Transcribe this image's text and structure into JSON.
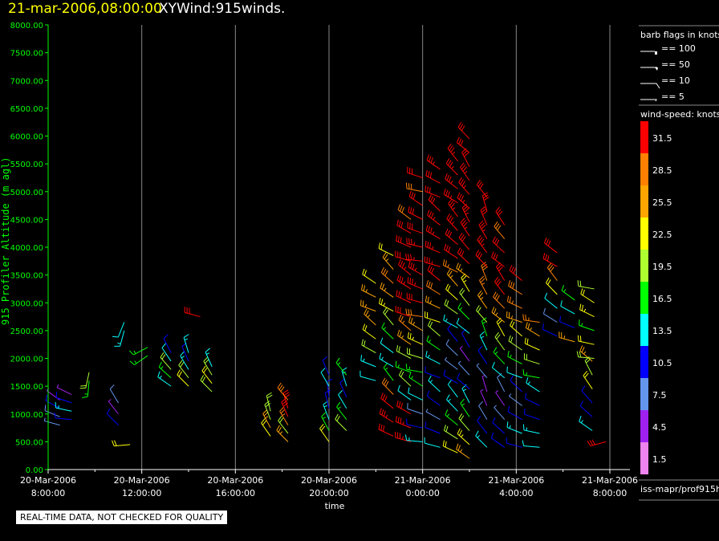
{
  "header": {
    "date": "21-mar-2006,08:00:00",
    "title": "XYWind:915winds."
  },
  "notice": "REAL-TIME DATA, NOT CHECKED FOR QUALITY",
  "source": "iss-mapr/prof915h",
  "legend": {
    "barb_title": "barb flags in knots",
    "barb_items": [
      "== 100",
      "== 50",
      "== 10",
      "== 5"
    ],
    "speed_title": "wind-speed: knots",
    "speed_bins": [
      {
        "label": "31.5",
        "color": "#ff0000"
      },
      {
        "label": "28.5",
        "color": "#ff8000"
      },
      {
        "label": "25.5",
        "color": "#ffa500"
      },
      {
        "label": "22.5",
        "color": "#ffff00"
      },
      {
        "label": "19.5",
        "color": "#adff2f"
      },
      {
        "label": "16.5",
        "color": "#00ff00"
      },
      {
        "label": "13.5",
        "color": "#00ffff"
      },
      {
        "label": "10.5",
        "color": "#0000ff"
      },
      {
        "label": "7.5",
        "color": "#6495ed"
      },
      {
        "label": "4.5",
        "color": "#a020f0"
      },
      {
        "label": "1.5",
        "color": "#ee82ee"
      }
    ]
  },
  "chart_data": {
    "type": "wind-barb",
    "xlabel": "time",
    "ylabel": "915 Profiler Altitude (m agl)",
    "xlim": [
      "2006-03-20 08:00",
      "2006-03-21 08:00"
    ],
    "ylim": [
      0,
      8000
    ],
    "yticks": [
      "0.00",
      "500.00",
      "1000.00",
      "1500.00",
      "2000.00",
      "2500.00",
      "3000.00",
      "3500.00",
      "4000.00",
      "4500.00",
      "5000.00",
      "5500.00",
      "6000.00",
      "6500.00",
      "7000.00",
      "7500.00",
      "8000.00"
    ],
    "xticks": [
      {
        "t": "2006-03-20 08:00",
        "l1": "20-Mar-2006",
        "l2": "8:00:00"
      },
      {
        "t": "2006-03-20 12:00",
        "l1": "20-Mar-2006",
        "l2": "12:00:00"
      },
      {
        "t": "2006-03-20 16:00",
        "l1": "20-Mar-2006",
        "l2": "16:00:00"
      },
      {
        "t": "2006-03-20 20:00",
        "l1": "20-Mar-2006",
        "l2": "20:00:00"
      },
      {
        "t": "2006-03-21 00:00",
        "l1": "21-Mar-2006",
        "l2": "0:00:00"
      },
      {
        "t": "2006-03-21 04:00",
        "l1": "21-Mar-2006",
        "l2": "4:00:00"
      },
      {
        "t": "2006-03-21 08:00",
        "l1": "21-Mar-2006",
        "l2": "8:00:00"
      }
    ],
    "grid": "vertical",
    "profiles": [
      {
        "time": "2006-03-20 08:30",
        "alt_start": 800,
        "alt_step": 150,
        "dir": 300,
        "speed": [
          6,
          8,
          11,
          5
        ]
      },
      {
        "time": "2006-03-20 09:00",
        "alt_start": 900,
        "alt_step": 150,
        "dir": 290,
        "speed": [
          10,
          13,
          9,
          4
        ]
      },
      {
        "time": "2006-03-20 09:45",
        "alt_start": 1600,
        "alt_step": 150,
        "dir": 200,
        "speed": [
          17,
          18
        ]
      },
      {
        "time": "2006-03-20 11:00",
        "alt_start": 800,
        "alt_step": 200,
        "dir": 330,
        "speed": [
          10,
          5,
          8
        ]
      },
      {
        "time": "2006-03-20 11:15",
        "alt_start": 2500,
        "alt_step": 150,
        "dir": 210,
        "speed": [
          13,
          12
        ]
      },
      {
        "time": "2006-03-20 11:30",
        "alt_start": 450,
        "alt_step": 150,
        "dir": 280,
        "speed": [
          21
        ]
      },
      {
        "time": "2006-03-20 12:15",
        "alt_start": 2050,
        "alt_step": 150,
        "dir": 250,
        "speed": [
          16,
          17
        ]
      },
      {
        "time": "2006-03-20 13:15",
        "alt_start": 1500,
        "alt_step": 150,
        "dir": 320,
        "speed": [
          14,
          16,
          19,
          12,
          10
        ]
      },
      {
        "time": "2006-03-20 14:00",
        "alt_start": 1500,
        "alt_step": 150,
        "dir": 330,
        "speed": [
          22,
          18,
          14,
          11,
          13
        ]
      },
      {
        "time": "2006-03-20 14:30",
        "alt_start": 2750,
        "alt_step": 150,
        "dir": 300,
        "speed": [
          31
        ]
      },
      {
        "time": "2006-03-20 15:00",
        "alt_start": 1400,
        "alt_step": 150,
        "dir": 330,
        "speed": [
          20,
          22,
          19,
          14
        ]
      },
      {
        "time": "2006-03-20 17:30",
        "alt_start": 600,
        "alt_step": 150,
        "dir": 340,
        "speed": [
          22,
          25,
          18,
          20
        ]
      },
      {
        "time": "2006-03-20 18:15",
        "alt_start": 500,
        "alt_step": 150,
        "dir": 330,
        "speed": [
          24,
          20,
          27,
          31,
          30,
          28
        ]
      },
      {
        "time": "2006-03-20 20:00",
        "alt_start": 500,
        "alt_step": 200,
        "dir": 340,
        "speed": [
          22,
          16,
          14,
          11,
          10,
          12,
          9
        ]
      },
      {
        "time": "2006-03-20 20:45",
        "alt_start": 700,
        "alt_step": 200,
        "dir": 330,
        "speed": [
          18,
          15,
          12,
          10,
          13,
          16
        ]
      },
      {
        "time": "2006-03-20 22:00",
        "alt_start": 1600,
        "alt_step": 250,
        "dir": 300,
        "speed": [
          12,
          14,
          19,
          22,
          24,
          26,
          25,
          22
        ]
      },
      {
        "time": "2006-03-20 22:45",
        "alt_start": 600,
        "alt_step": 250,
        "dir": 310,
        "speed": [
          31,
          33,
          30,
          28,
          16,
          14,
          12,
          17,
          20,
          23,
          26,
          28,
          25,
          22
        ]
      },
      {
        "time": "2006-03-20 23:30",
        "alt_start": 500,
        "alt_step": 250,
        "dir": 300,
        "speed": [
          33,
          35,
          31,
          12,
          18,
          15,
          19,
          24,
          27,
          30,
          32,
          34,
          33,
          32,
          31,
          30,
          28
        ]
      },
      {
        "time": "2006-03-21 00:00",
        "alt_start": 500,
        "alt_step": 250,
        "dir": 290,
        "speed": [
          14,
          10,
          8,
          12,
          15,
          17,
          20,
          23,
          26,
          29,
          31,
          33,
          34,
          35,
          33,
          32,
          31,
          30,
          29,
          31
        ]
      },
      {
        "time": "2006-03-21 00:45",
        "alt_start": 400,
        "alt_step": 250,
        "dir": 300,
        "speed": [
          12,
          9,
          7,
          10,
          13,
          11,
          14,
          17,
          19,
          22,
          25,
          28,
          31,
          33,
          34,
          35,
          33,
          32,
          31,
          32,
          34
        ]
      },
      {
        "time": "2006-03-21 01:30",
        "alt_start": 300,
        "alt_step": 250,
        "dir": 310,
        "speed": [
          22,
          20,
          17,
          14,
          12,
          9,
          6,
          8,
          11,
          14,
          18,
          21,
          24,
          27,
          30,
          32,
          34,
          35,
          33,
          34,
          36,
          35
        ]
      },
      {
        "time": "2006-03-21 02:00",
        "alt_start": 200,
        "alt_step": 250,
        "dir": 320,
        "speed": [
          25,
          23,
          18,
          16,
          13,
          10,
          7,
          5,
          9,
          12,
          15,
          19,
          23,
          26,
          30,
          32,
          34,
          33,
          35,
          34,
          33,
          32,
          31,
          31
        ]
      },
      {
        "time": "2006-03-21 02:45",
        "alt_start": 400,
        "alt_step": 250,
        "dir": 330,
        "speed": [
          14,
          11,
          8,
          5,
          4,
          7,
          10,
          13,
          16,
          20,
          24,
          27,
          29,
          31,
          33,
          34,
          32,
          31,
          30
        ]
      },
      {
        "time": "2006-03-21 03:30",
        "alt_start": 400,
        "alt_step": 250,
        "dir": 320,
        "speed": [
          9,
          11,
          6,
          4,
          8,
          12,
          15,
          19,
          22,
          25,
          28,
          30,
          32,
          31,
          30,
          29,
          31
        ]
      },
      {
        "time": "2006-03-21 04:15",
        "alt_start": 400,
        "alt_step": 250,
        "dir": 300,
        "speed": [
          11,
          13,
          10,
          7,
          9,
          12,
          15,
          18,
          21,
          24,
          27,
          29,
          31
        ]
      },
      {
        "time": "2006-03-21 05:00",
        "alt_start": 400,
        "alt_step": 250,
        "dir": 290,
        "speed": [
          12,
          14,
          11,
          9,
          13,
          16,
          19,
          22,
          25,
          27
        ]
      },
      {
        "time": "2006-03-21 05:45",
        "alt_start": 2400,
        "alt_step": 250,
        "dir": 310,
        "speed": [
          10,
          8,
          12,
          22,
          28,
          31,
          32
        ]
      },
      {
        "time": "2006-03-21 06:30",
        "alt_start": 2300,
        "alt_step": 250,
        "dir": 300,
        "speed": [
          26,
          9,
          12,
          15
        ]
      },
      {
        "time": "2006-03-21 07:15",
        "alt_start": 700,
        "alt_step": 250,
        "dir": 320,
        "speed": [
          14,
          10,
          9,
          22,
          20,
          25
        ]
      },
      {
        "time": "2006-03-21 07:20",
        "alt_start": 2000,
        "alt_step": 250,
        "dir": 290,
        "speed": [
          18,
          21,
          16,
          23,
          22,
          19
        ]
      },
      {
        "time": "2006-03-21 07:50",
        "alt_start": 500,
        "alt_step": 150,
        "dir": 270,
        "speed": [
          32
        ]
      }
    ]
  }
}
